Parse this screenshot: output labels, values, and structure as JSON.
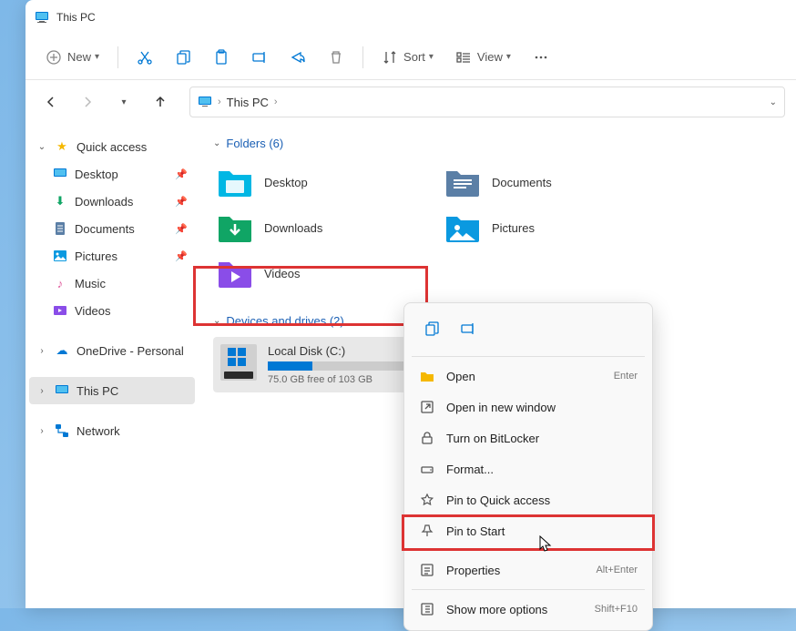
{
  "window": {
    "title": "This PC"
  },
  "toolbar": {
    "new": "New",
    "sort": "Sort",
    "view": "View"
  },
  "breadcrumb": {
    "location": "This PC"
  },
  "sidebar": {
    "quick_access": "Quick access",
    "items": [
      {
        "label": "Desktop"
      },
      {
        "label": "Downloads"
      },
      {
        "label": "Documents"
      },
      {
        "label": "Pictures"
      },
      {
        "label": "Music"
      },
      {
        "label": "Videos"
      }
    ],
    "onedrive": "OneDrive - Personal",
    "this_pc": "This PC",
    "network": "Network"
  },
  "sections": {
    "folders": {
      "title": "Folders (6)"
    },
    "drives": {
      "title": "Devices and drives (2)"
    }
  },
  "folders": [
    {
      "label": "Desktop",
      "color": "#00b7e4"
    },
    {
      "label": "Documents",
      "color": "#5b7fa6"
    },
    {
      "label": "Downloads",
      "color": "#10a565"
    },
    {
      "label": "Pictures",
      "color": "#0a99e0"
    },
    {
      "label": "Videos",
      "color": "#8a4de8"
    }
  ],
  "drive": {
    "name": "Local Disk (C:)",
    "free": "75.0 GB free of 103 GB"
  },
  "context_menu": {
    "open": "Open",
    "open_shortcut": "Enter",
    "open_new": "Open in new window",
    "bitlocker": "Turn on BitLocker",
    "format": "Format...",
    "pin_quick": "Pin to Quick access",
    "pin_start": "Pin to Start",
    "properties": "Properties",
    "properties_shortcut": "Alt+Enter",
    "more": "Show more options",
    "more_shortcut": "Shift+F10"
  }
}
